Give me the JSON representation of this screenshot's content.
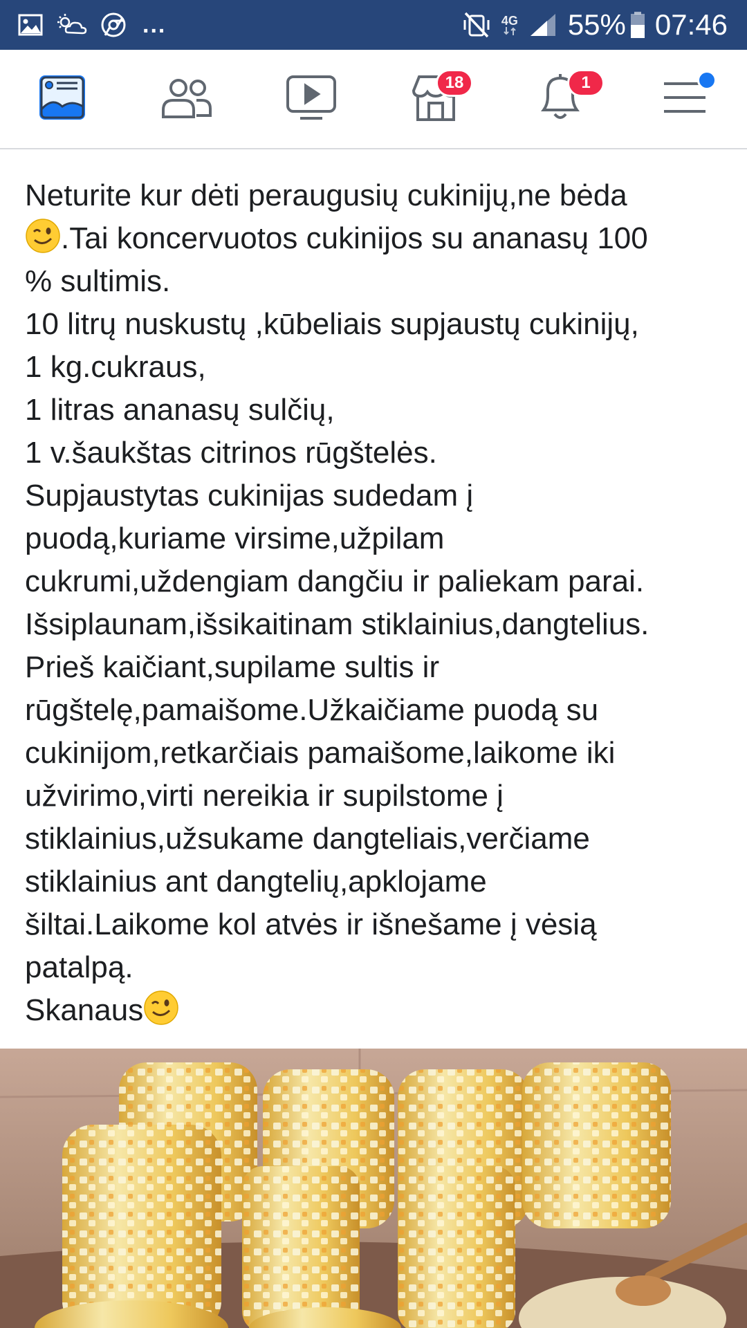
{
  "status_bar": {
    "network_label": "4G",
    "battery": "55%",
    "time": "07:46",
    "overflow": "...",
    "icons": [
      "gallery-icon",
      "weather-icon",
      "chrome-icon",
      "mute-vibrate-icon",
      "signal-icon",
      "battery-icon"
    ]
  },
  "nav": {
    "items": [
      {
        "name": "news-feed",
        "icon": "news-feed-icon",
        "active": true
      },
      {
        "name": "friends",
        "icon": "friends-icon"
      },
      {
        "name": "watch",
        "icon": "video-play-icon"
      },
      {
        "name": "marketplace",
        "icon": "marketplace-icon",
        "badge": "18"
      },
      {
        "name": "notifications",
        "icon": "bell-icon",
        "badge": "1"
      },
      {
        "name": "menu",
        "icon": "hamburger-menu-icon",
        "dot": true
      }
    ],
    "active_color": "#1877f2",
    "badge_color": "#f02849"
  },
  "post": {
    "lines": [
      "Neturite kur dėti peraugusių cukinijų,ne bėda",
      ".Tai koncervuotos cukinijos su ananasų 100",
      "% sultimis.",
      "10 litrų nuskustų ,kūbeliais supjaustų cukinijų,",
      "1 kg.cukraus,",
      "1 litras ananasų sulčių,",
      "1 v.šaukštas citrinos rūgštelės.",
      "Supjaustytas cukinijas sudedam į",
      "puodą,kuriame virsime,užpilam",
      "cukrumi,uždengiam dangčiu ir paliekam parai.",
      "Išsiplaunam,išsikaitinam stiklainius,dangtelius.",
      "Prieš kaičiant,supilame sultis ir",
      "rūgštelę,pamaišome.Užkaičiame puodą su",
      "cukinijom,retkarčiais pamaišome,laikome iki",
      "užvirimo,virti nereikia ir supilstome į",
      "stiklainius,užsukame dangteliais,verčiame",
      "stiklainius ant dangtelių,apklojame",
      "šiltai.Laikome kol atvės ir išnešame į vėsią",
      "patalpą.",
      "Skanaus"
    ],
    "emoji": "winking-face-emoji",
    "text_color": "#1c1e21",
    "photo": "jars-of-preserved-zucchini-photo"
  }
}
